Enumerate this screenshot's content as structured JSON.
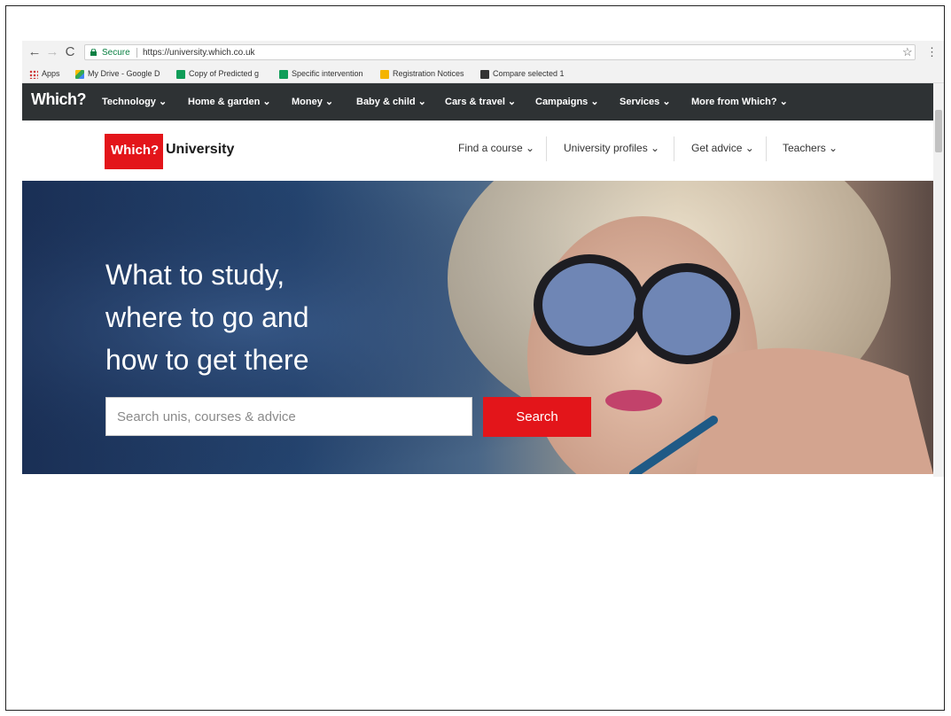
{
  "browser": {
    "secure_label": "Secure",
    "url": "https://university.which.co.uk",
    "bookmarks": [
      {
        "label": "Apps",
        "icon": "apps-grid-icon"
      },
      {
        "label": "My Drive - Google D",
        "icon": "google-drive-icon"
      },
      {
        "label": "Copy of Predicted g",
        "icon": "sheets-icon"
      },
      {
        "label": "Specific intervention",
        "icon": "sheets-icon"
      },
      {
        "label": "Registration Notices",
        "icon": "slides-icon"
      },
      {
        "label": "Compare selected 1",
        "icon": "compare-icon"
      }
    ]
  },
  "topnav": {
    "logo": "Which?",
    "items": [
      {
        "label": "Technology ⌄"
      },
      {
        "label": "Home & garden ⌄"
      },
      {
        "label": "Money ⌄"
      },
      {
        "label": "Baby & child ⌄"
      },
      {
        "label": "Cars & travel ⌄"
      },
      {
        "label": "Campaigns ⌄"
      },
      {
        "label": "Services ⌄"
      },
      {
        "label": "More from Which? ⌄"
      }
    ]
  },
  "uni_header": {
    "logo_which": "Which?",
    "logo_text": "University",
    "nav": [
      {
        "label": "Find a course ⌄"
      },
      {
        "label": "University profiles ⌄"
      },
      {
        "label": "Get advice ⌄"
      },
      {
        "label": "Teachers ⌄"
      }
    ]
  },
  "hero": {
    "title_lines": [
      "What to study,",
      "where to go and",
      "how to get there"
    ],
    "search_placeholder": "Search unis, courses & advice",
    "search_button": "Search"
  },
  "colors": {
    "brand_red": "#e3151a",
    "nav_dark": "#2e3234",
    "hero_blue": "#1a2f55"
  }
}
